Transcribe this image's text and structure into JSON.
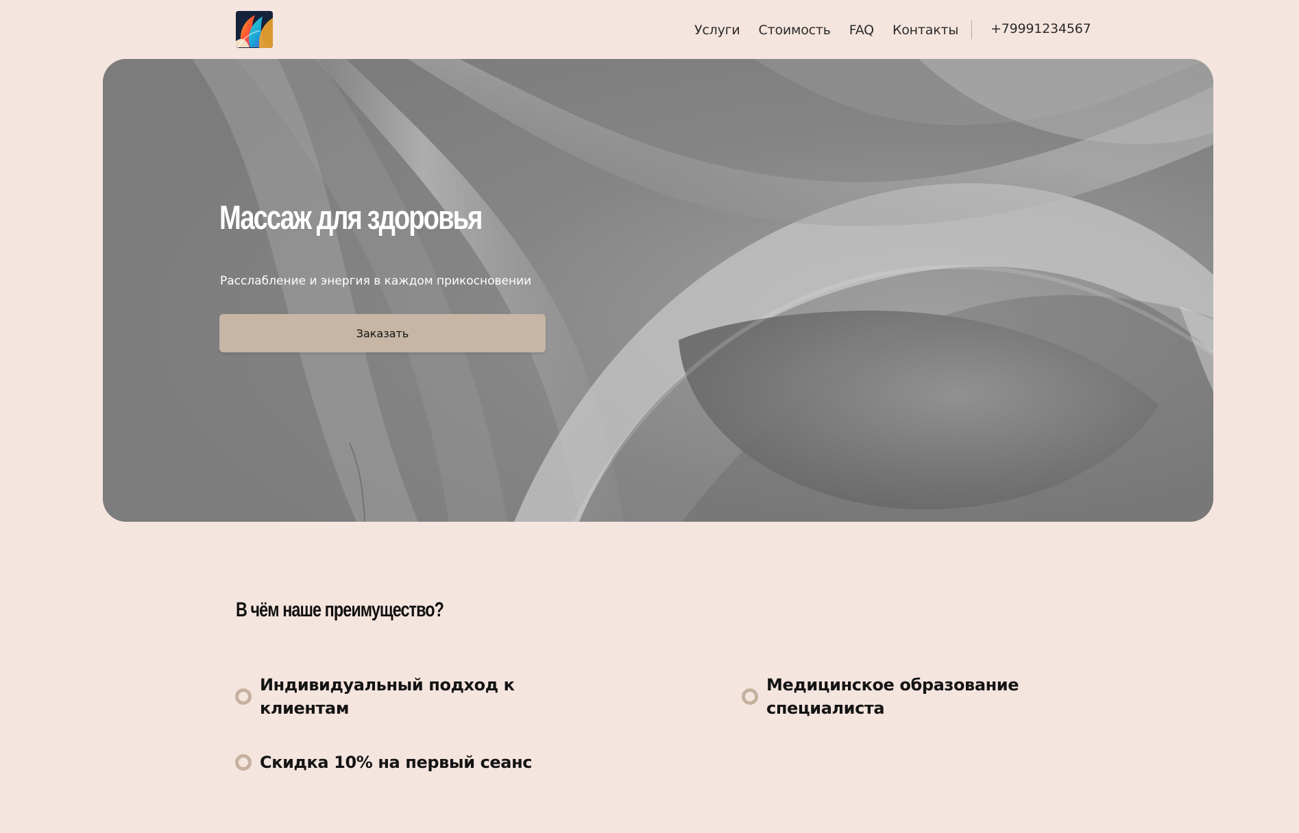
{
  "header": {
    "logo_icon": "colorful-hair-logo-icon",
    "nav": [
      {
        "label": "Услуги"
      },
      {
        "label": "Стоимость"
      },
      {
        "label": "FAQ"
      },
      {
        "label": "Контакты"
      }
    ],
    "phone": "+79991234567"
  },
  "hero": {
    "title": "Массаж для здоровья",
    "subtitle": "Расслабление и энергия в каждом прикосновении",
    "cta_label": "Заказать",
    "background": "abstract-gray-waves-image"
  },
  "advantages": {
    "title": "В чём наше преимущество?",
    "items": [
      {
        "text": "Индивидуальный подход к клиентам"
      },
      {
        "text": "Медицинское образование специалиста"
      },
      {
        "text": "Скидка 10% на первый сеанс"
      }
    ]
  },
  "colors": {
    "page_background": "#f5e5df",
    "accent": "#c7b6a5",
    "bullet": "#c6b1a0",
    "hero_gray": "#8d8d8d"
  }
}
